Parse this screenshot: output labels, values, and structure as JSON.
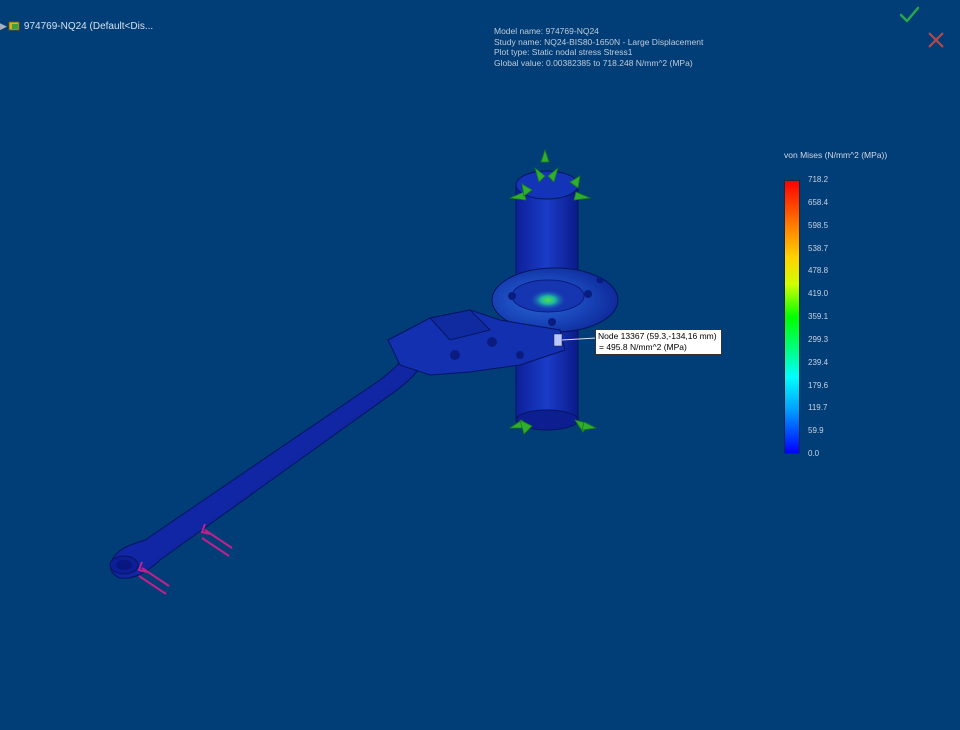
{
  "header": {
    "tree_label": "974769-NQ24 (Default<Dis..."
  },
  "info": {
    "model_name": "Model name: 974769-NQ24",
    "study_name": "Study name: NQ24-BIS80-1650N - Large Displacement",
    "plot_type": "Plot type: Static nodal stress Stress1",
    "global_value": "Global value: 0.00382385 to 718.248 N/mm^2 (MPa)"
  },
  "legend": {
    "title": "von Mises (N/mm^2 (MPa))",
    "ticks": [
      "718.2",
      "658.4",
      "598.5",
      "538.7",
      "478.8",
      "419.0",
      "359.1",
      "299.3",
      "239.4",
      "179.6",
      "119.7",
      "59.9",
      "0.0"
    ],
    "colors": [
      "#ff0000",
      "#ff7a00",
      "#ffd200",
      "#d0ff00",
      "#00ff00",
      "#00ff80",
      "#00ffff",
      "#00a0ff",
      "#0000ff"
    ]
  },
  "probe": {
    "node_line": "Node 13367 (59.3,-134,16 mm)",
    "value_line": "= 495.8    N/mm^2 (MPa)"
  },
  "icons": {
    "confirm": "checkmark-icon",
    "cancel": "close-icon",
    "part": "part-icon",
    "fixture": "fixed-geometry-icon",
    "load": "force-arrow-icon"
  },
  "colors": {
    "background": "#013E77",
    "confirm": "#2aa64a",
    "cancel": "#b84a4a",
    "fixture": "#2fae2f",
    "load": "#c0208c",
    "model_base": "#0a1d8a"
  }
}
